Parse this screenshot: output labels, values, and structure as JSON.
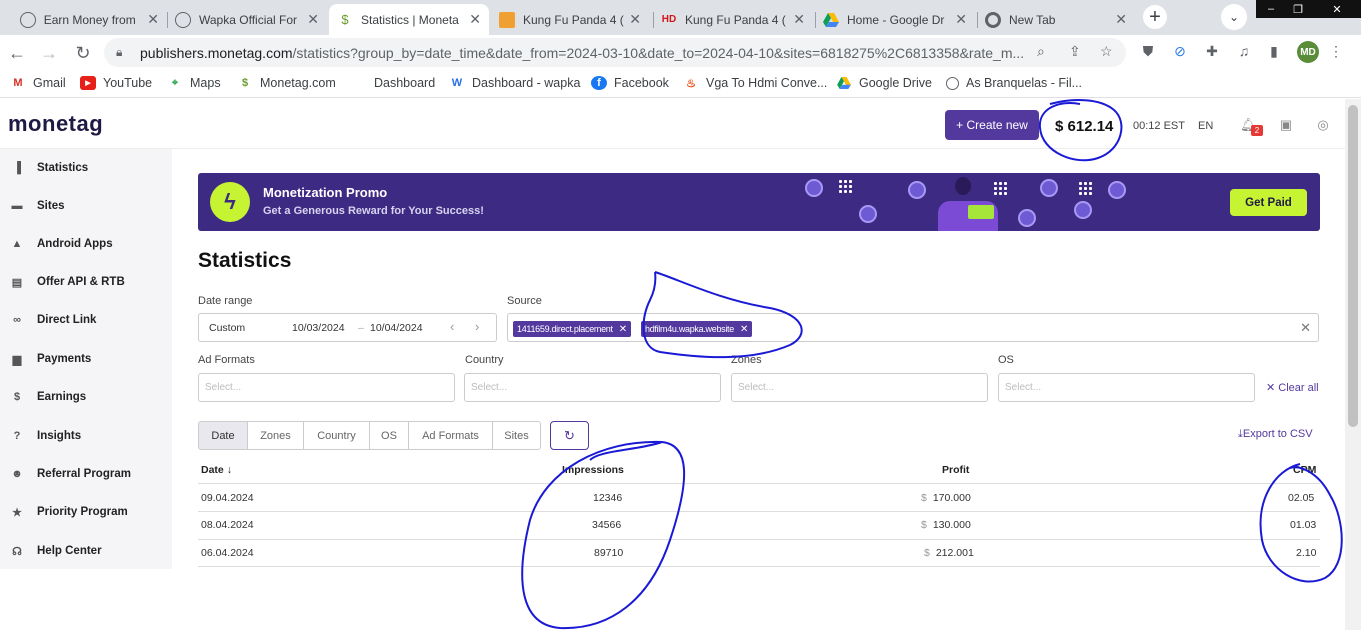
{
  "browser": {
    "tabs": [
      {
        "title": "Earn Money from ",
        "icon": "globe-icon",
        "active": false
      },
      {
        "title": "Wapka Official For",
        "icon": "globe-icon",
        "active": false
      },
      {
        "title": "Statistics | Moneta",
        "icon": "monetag-icon",
        "active": true
      },
      {
        "title": "Kung Fu Panda 4 (",
        "icon": "video-icon",
        "active": false
      },
      {
        "title": "Kung Fu Panda 4 (",
        "icon": "hd-icon",
        "active": false
      },
      {
        "title": "Home - Google Dr",
        "icon": "drive-icon",
        "active": false
      },
      {
        "title": "New Tab",
        "icon": "chrome-icon",
        "active": false
      }
    ],
    "url_host": "publishers.monetag.com",
    "url_path": "/statistics?group_by=date_time&date_from=2024-03-10&date_to=2024-04-10&sites=6818275%2C6813358&rate_m...",
    "profile_initials": "MD",
    "bookmarks": [
      {
        "label": "Gmail",
        "icon": "gmail-icon"
      },
      {
        "label": "YouTube",
        "icon": "youtube-icon"
      },
      {
        "label": "Maps",
        "icon": "maps-icon"
      },
      {
        "label": "Monetag.com",
        "icon": "monetag-icon"
      },
      {
        "label": "Dashboard",
        "icon": "none"
      },
      {
        "label": "Dashboard - wapka",
        "icon": "wapka-icon"
      },
      {
        "label": "Facebook",
        "icon": "facebook-icon"
      },
      {
        "label": "Vga To Hdmi Conve...",
        "icon": "fire-icon"
      },
      {
        "label": "Google Drive",
        "icon": "drive-icon"
      },
      {
        "label": "As Branquelas - Fil...",
        "icon": "globe-icon"
      }
    ]
  },
  "header": {
    "logo": "monetag",
    "create_label": "+ Create new",
    "balance": "$ 612.14",
    "time": "00:12 EST",
    "lang": "EN",
    "notif_count": "2"
  },
  "sidebar": {
    "items": [
      {
        "label": "Statistics",
        "icon": "chart-icon"
      },
      {
        "label": "Sites",
        "icon": "sites-icon"
      },
      {
        "label": "Android Apps",
        "icon": "android-icon"
      },
      {
        "label": "Offer API & RTB",
        "icon": "document-icon"
      },
      {
        "label": "Direct Link",
        "icon": "link-icon"
      },
      {
        "label": "Payments",
        "icon": "wallet-icon"
      },
      {
        "label": "Earnings",
        "icon": "dollar-icon"
      },
      {
        "label": "Insights",
        "icon": "help-icon"
      },
      {
        "label": "Referral Program",
        "icon": "users-icon"
      },
      {
        "label": "Priority Program",
        "icon": "star-icon"
      },
      {
        "label": "Help Center",
        "icon": "headset-icon"
      }
    ]
  },
  "promo": {
    "title": "Monetization Promo",
    "subtitle": "Get a Generous Reward for Your Success!",
    "cta": "Get Paid"
  },
  "page": {
    "title": "Statistics",
    "filters": {
      "date_range_label": "Date range",
      "date_mode": "Custom",
      "date_from": "10/03/2024",
      "date_sep": "–",
      "date_to": "10/04/2024",
      "source_label": "Source",
      "source_chips": [
        "1411659.direct.placement",
        "hdfilm4u.wapka.website"
      ],
      "ad_formats_label": "Ad Formats",
      "country_label": "Country",
      "zones_label": "Zones",
      "os_label": "OS",
      "select_placeholder": "Select...",
      "clear_all": "Clear all"
    },
    "group_tabs": [
      "Date",
      "Zones",
      "Country",
      "OS",
      "Ad Formats",
      "Sites"
    ],
    "export_label": "Export to CSV",
    "table": {
      "columns": [
        "Date",
        "Impressions",
        "Profit",
        "CPM"
      ],
      "currency": "$",
      "rows": [
        {
          "date": "09.04.2024",
          "impressions": "12346",
          "profit": "170.000",
          "cpm": "02.05"
        },
        {
          "date": "08.04.2024",
          "impressions": "34566",
          "profit": "130.000",
          "cpm": "01.03"
        },
        {
          "date": "06.04.2024",
          "impressions": "89710",
          "profit": "212.001",
          "cpm": "2.10"
        }
      ]
    }
  },
  "colors": {
    "brand": "#53389e",
    "promo_bg": "#3d2a83",
    "lime": "#c6f432",
    "ink_annotation": "#1a1ad6"
  }
}
